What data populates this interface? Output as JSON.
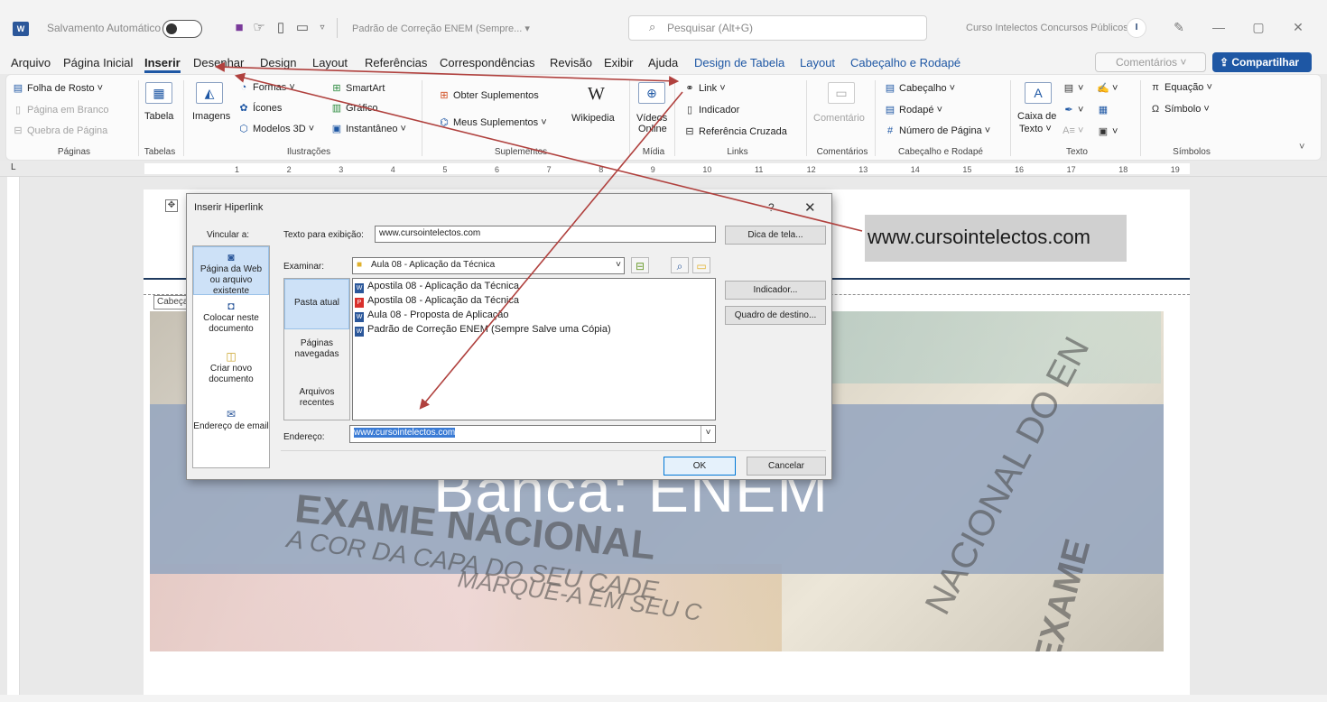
{
  "titlebar": {
    "autosave_label": "Salvamento Automático",
    "doc_title": "Padrão de Correção ENEM (Sempre... ▾",
    "search_placeholder": "Pesquisar (Alt+G)",
    "account_name": "Curso Intelectos Concursos Públicos",
    "avatar_text": "I"
  },
  "menu": {
    "items": [
      "Arquivo",
      "Página Inicial",
      "Inserir",
      "Desenhar",
      "Design",
      "Layout",
      "Referências",
      "Correspondências",
      "Revisão",
      "Exibir",
      "Ajuda",
      "Design de Tabela",
      "Layout",
      "Cabeçalho e Rodapé"
    ],
    "comments": "Comentários",
    "share": "Compartilhar"
  },
  "ribbon": {
    "paginas": {
      "cover": "Folha de Rosto ˅",
      "blank": "Página em Branco",
      "break": "Quebra de Página",
      "label": "Páginas"
    },
    "tabelas": {
      "table": "Tabela",
      "label": "Tabelas"
    },
    "ilustracoes": {
      "images": "Imagens",
      "shapes": "Formas ˅",
      "icons": "Ícones",
      "models": "Modelos 3D",
      "smartart": "SmartArt",
      "chart": "Gráfico",
      "snapshot": "Instantâneo ˅",
      "label": "Ilustrações"
    },
    "suplementos": {
      "get": "Obter Suplementos",
      "my": "Meus Suplementos",
      "wiki": "Wikipedia",
      "label": "Suplementos"
    },
    "midia": {
      "video1": "Vídeos",
      "video2": "Online",
      "label": "Mídia"
    },
    "links": {
      "link": "Link ˅",
      "bookmark": "Indicador",
      "crossref": "Referência Cruzada",
      "label": "Links"
    },
    "comentarios": {
      "comment": "Comentário",
      "label": "Comentários"
    },
    "cabecalho": {
      "header": "Cabeçalho ˅",
      "footer": "Rodapé ˅",
      "pagenum": "Número de Página ˅",
      "label": "Cabeçalho e Rodapé"
    },
    "texto": {
      "textbox1": "Caixa de",
      "textbox2": "Texto ˅",
      "label": "Texto"
    },
    "simbolos": {
      "equation": "Equação ˅",
      "symbol": "Símbolo ˅",
      "label": "Símbolos"
    }
  },
  "ruler": [
    "1",
    "2",
    "3",
    "4",
    "5",
    "6",
    "7",
    "8",
    "9",
    "10",
    "11",
    "12",
    "13",
    "14",
    "15",
    "16",
    "17",
    "18",
    "19"
  ],
  "document": {
    "header_url": "www.cursointelectos.com",
    "header_tag": "Cabeçalho",
    "banner": "Banca: ENEM",
    "watermarks": [
      "EXAME NACIONAL",
      "A COR DA CAPA DO SEU CADE",
      "MARQUE-A EM SEU C",
      "NACIONAL DO EN",
      "EXAME"
    ]
  },
  "dialog": {
    "title": "Inserir Hiperlink",
    "help": "?",
    "close": "✕",
    "link_to_label": "Vincular a:",
    "link_to": [
      {
        "icon": "web-page-icon",
        "label": "Página da Web ou arquivo existente"
      },
      {
        "icon": "document-place-icon",
        "label": "Colocar neste documento"
      },
      {
        "icon": "new-document-icon",
        "label": "Criar novo documento"
      },
      {
        "icon": "email-icon",
        "label": "Endereço de email"
      }
    ],
    "display_text_label": "Texto para exibição:",
    "display_text": "www.cursointelectos.com",
    "screentip": "Dica de tela...",
    "look_in_label": "Examinar:",
    "look_in_value": "Aula 08 - Aplicação da Técnica",
    "nav": {
      "current": "Pasta atual",
      "browsed": "Páginas navegadas",
      "recent": "Arquivos recentes"
    },
    "files": [
      {
        "type": "word",
        "name": "Apostila 08 - Aplicação da Técnica"
      },
      {
        "type": "pdf",
        "name": "Apostila 08 - Aplicação da Técnica"
      },
      {
        "type": "word",
        "name": "Aula 08 - Proposta de Aplicação"
      },
      {
        "type": "word",
        "name": "Padrão de Correção ENEM (Sempre Salve uma Cópia)"
      }
    ],
    "bookmark_btn": "Indicador...",
    "target_frame_btn": "Quadro de destino...",
    "address_label": "Endereço:",
    "address": "www.cursointelectos.com",
    "ok": "OK",
    "cancel": "Cancelar"
  },
  "colors": {
    "accent": "#1e57a4",
    "arrow": "#b0413e",
    "banner_band": "#96a6bf"
  }
}
